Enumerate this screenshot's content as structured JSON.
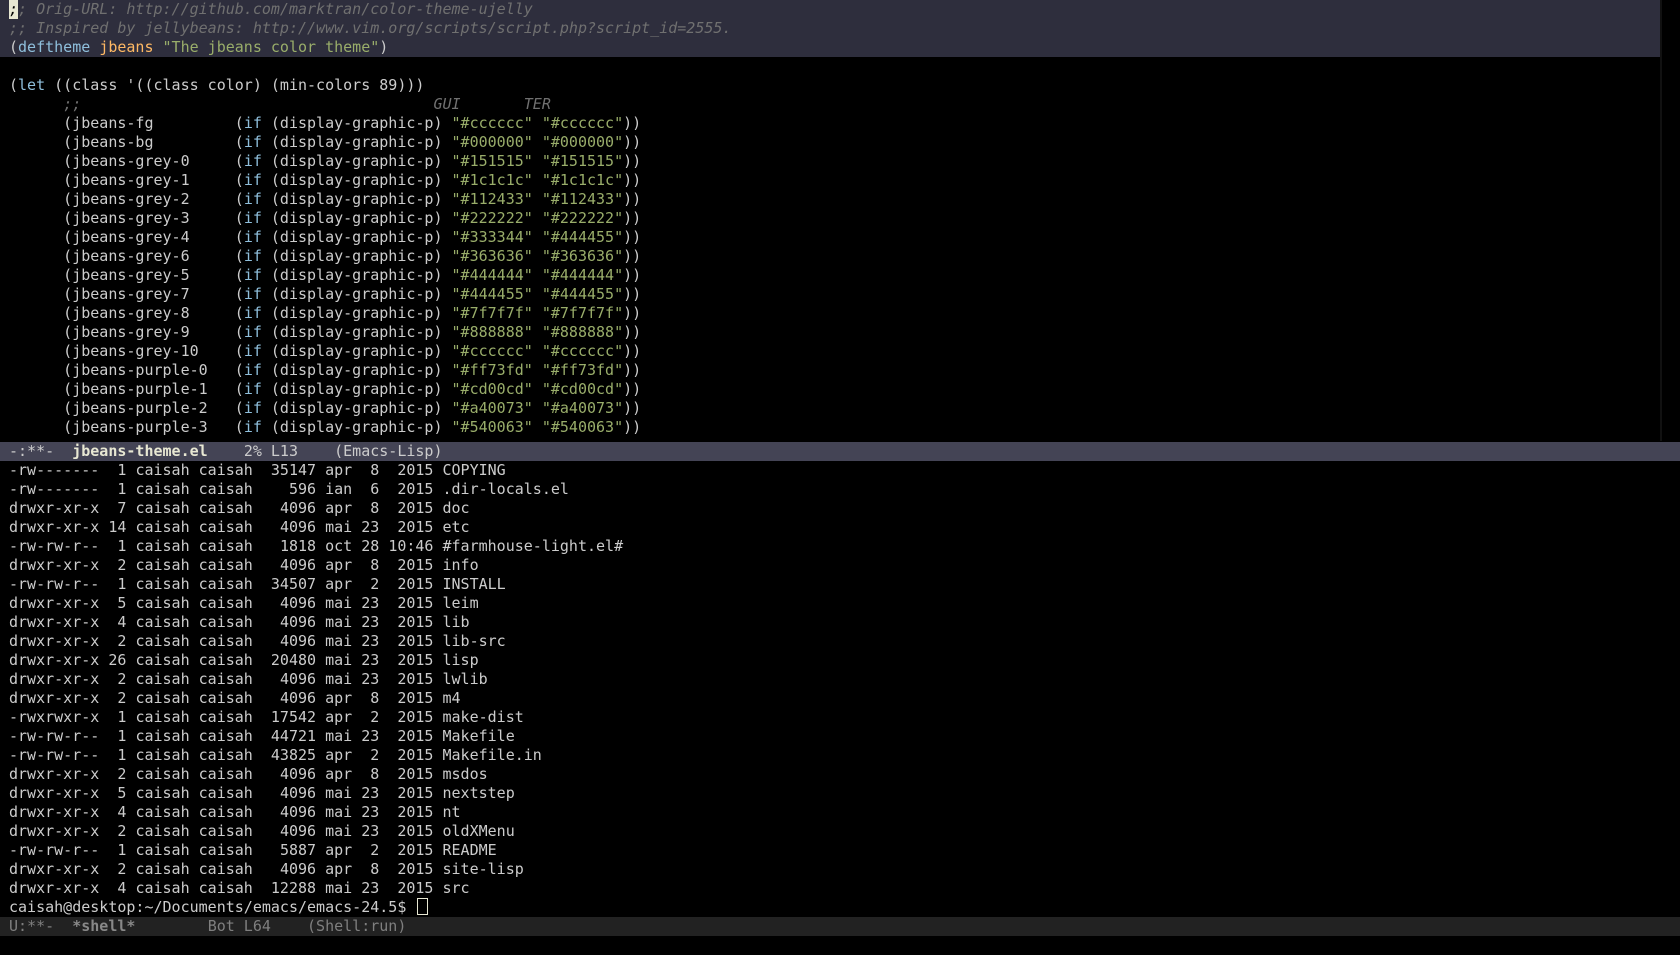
{
  "top_buffer": {
    "header_comments": [
      ";; Orig-URL: http://github.com/marktran/color-theme-ujelly",
      ";; Inspired by jellybeans: http://www.vim.org/scripts/script.php?script_id=2555."
    ],
    "deftheme": {
      "open": "(",
      "keyword": "deftheme",
      "name": "jbeans",
      "docstring": "\"The jbeans color theme\"",
      "close": ")"
    },
    "let_line": {
      "open": "(",
      "keyword": "let",
      "rest": " ((class '((class color) (min-colors 89)))"
    },
    "column_comment": ";;",
    "column_header_gui": "GUI",
    "column_header_ter": "TER",
    "color_rows": [
      {
        "name": "jbeans-fg",
        "gui": "\"#cccccc\"",
        "ter": "\"#cccccc\""
      },
      {
        "name": "jbeans-bg",
        "gui": "\"#000000\"",
        "ter": "\"#000000\""
      },
      {
        "name": "jbeans-grey-0",
        "gui": "\"#151515\"",
        "ter": "\"#151515\""
      },
      {
        "name": "jbeans-grey-1",
        "gui": "\"#1c1c1c\"",
        "ter": "\"#1c1c1c\""
      },
      {
        "name": "jbeans-grey-2",
        "gui": "\"#112433\"",
        "ter": "\"#112433\""
      },
      {
        "name": "jbeans-grey-3",
        "gui": "\"#222222\"",
        "ter": "\"#222222\""
      },
      {
        "name": "jbeans-grey-4",
        "gui": "\"#333344\"",
        "ter": "\"#444455\""
      },
      {
        "name": "jbeans-grey-6",
        "gui": "\"#363636\"",
        "ter": "\"#363636\""
      },
      {
        "name": "jbeans-grey-5",
        "gui": "\"#444444\"",
        "ter": "\"#444444\""
      },
      {
        "name": "jbeans-grey-7",
        "gui": "\"#444455\"",
        "ter": "\"#444455\""
      },
      {
        "name": "jbeans-grey-8",
        "gui": "\"#7f7f7f\"",
        "ter": "\"#7f7f7f\""
      },
      {
        "name": "jbeans-grey-9",
        "gui": "\"#888888\"",
        "ter": "\"#888888\""
      },
      {
        "name": "jbeans-grey-10",
        "gui": "\"#cccccc\"",
        "ter": "\"#cccccc\""
      },
      {
        "name": "jbeans-purple-0",
        "gui": "\"#ff73fd\"",
        "ter": "\"#ff73fd\""
      },
      {
        "name": "jbeans-purple-1",
        "gui": "\"#cd00cd\"",
        "ter": "\"#cd00cd\""
      },
      {
        "name": "jbeans-purple-2",
        "gui": "\"#a40073\"",
        "ter": "\"#a40073\""
      },
      {
        "name": "jbeans-purple-3",
        "gui": "\"#540063\"",
        "ter": "\"#540063\""
      }
    ],
    "if_keyword": "if",
    "predicate": "(display-graphic-p)"
  },
  "top_modeline": {
    "status": "-:**-",
    "buffer_name": "jbeans-theme.el",
    "position": "2% L13",
    "mode": "(Emacs-Lisp)"
  },
  "shell_buffer": {
    "listing": [
      {
        "perms": "-rw-------",
        "links": "1",
        "owner": "caisah",
        "group": "caisah",
        "size": "35147",
        "month": "apr",
        "day": "8",
        "time": "2015",
        "name": "COPYING"
      },
      {
        "perms": "-rw-------",
        "links": "1",
        "owner": "caisah",
        "group": "caisah",
        "size": "596",
        "month": "ian",
        "day": "6",
        "time": "2015",
        "name": ".dir-locals.el"
      },
      {
        "perms": "drwxr-xr-x",
        "links": "7",
        "owner": "caisah",
        "group": "caisah",
        "size": "4096",
        "month": "apr",
        "day": "8",
        "time": "2015",
        "name": "doc"
      },
      {
        "perms": "drwxr-xr-x",
        "links": "14",
        "owner": "caisah",
        "group": "caisah",
        "size": "4096",
        "month": "mai",
        "day": "23",
        "time": "2015",
        "name": "etc"
      },
      {
        "perms": "-rw-rw-r--",
        "links": "1",
        "owner": "caisah",
        "group": "caisah",
        "size": "1818",
        "month": "oct",
        "day": "28",
        "time": "10:46",
        "name": "#farmhouse-light.el#"
      },
      {
        "perms": "drwxr-xr-x",
        "links": "2",
        "owner": "caisah",
        "group": "caisah",
        "size": "4096",
        "month": "apr",
        "day": "8",
        "time": "2015",
        "name": "info"
      },
      {
        "perms": "-rw-rw-r--",
        "links": "1",
        "owner": "caisah",
        "group": "caisah",
        "size": "34507",
        "month": "apr",
        "day": "2",
        "time": "2015",
        "name": "INSTALL"
      },
      {
        "perms": "drwxr-xr-x",
        "links": "5",
        "owner": "caisah",
        "group": "caisah",
        "size": "4096",
        "month": "mai",
        "day": "23",
        "time": "2015",
        "name": "leim"
      },
      {
        "perms": "drwxr-xr-x",
        "links": "4",
        "owner": "caisah",
        "group": "caisah",
        "size": "4096",
        "month": "mai",
        "day": "23",
        "time": "2015",
        "name": "lib"
      },
      {
        "perms": "drwxr-xr-x",
        "links": "2",
        "owner": "caisah",
        "group": "caisah",
        "size": "4096",
        "month": "mai",
        "day": "23",
        "time": "2015",
        "name": "lib-src"
      },
      {
        "perms": "drwxr-xr-x",
        "links": "26",
        "owner": "caisah",
        "group": "caisah",
        "size": "20480",
        "month": "mai",
        "day": "23",
        "time": "2015",
        "name": "lisp"
      },
      {
        "perms": "drwxr-xr-x",
        "links": "2",
        "owner": "caisah",
        "group": "caisah",
        "size": "4096",
        "month": "mai",
        "day": "23",
        "time": "2015",
        "name": "lwlib"
      },
      {
        "perms": "drwxr-xr-x",
        "links": "2",
        "owner": "caisah",
        "group": "caisah",
        "size": "4096",
        "month": "apr",
        "day": "8",
        "time": "2015",
        "name": "m4"
      },
      {
        "perms": "-rwxrwxr-x",
        "links": "1",
        "owner": "caisah",
        "group": "caisah",
        "size": "17542",
        "month": "apr",
        "day": "2",
        "time": "2015",
        "name": "make-dist"
      },
      {
        "perms": "-rw-rw-r--",
        "links": "1",
        "owner": "caisah",
        "group": "caisah",
        "size": "44721",
        "month": "mai",
        "day": "23",
        "time": "2015",
        "name": "Makefile"
      },
      {
        "perms": "-rw-rw-r--",
        "links": "1",
        "owner": "caisah",
        "group": "caisah",
        "size": "43825",
        "month": "apr",
        "day": "2",
        "time": "2015",
        "name": "Makefile.in"
      },
      {
        "perms": "drwxr-xr-x",
        "links": "2",
        "owner": "caisah",
        "group": "caisah",
        "size": "4096",
        "month": "apr",
        "day": "8",
        "time": "2015",
        "name": "msdos"
      },
      {
        "perms": "drwxr-xr-x",
        "links": "5",
        "owner": "caisah",
        "group": "caisah",
        "size": "4096",
        "month": "mai",
        "day": "23",
        "time": "2015",
        "name": "nextstep"
      },
      {
        "perms": "drwxr-xr-x",
        "links": "4",
        "owner": "caisah",
        "group": "caisah",
        "size": "4096",
        "month": "mai",
        "day": "23",
        "time": "2015",
        "name": "nt"
      },
      {
        "perms": "drwxr-xr-x",
        "links": "2",
        "owner": "caisah",
        "group": "caisah",
        "size": "4096",
        "month": "mai",
        "day": "23",
        "time": "2015",
        "name": "oldXMenu"
      },
      {
        "perms": "-rw-rw-r--",
        "links": "1",
        "owner": "caisah",
        "group": "caisah",
        "size": "5887",
        "month": "apr",
        "day": "2",
        "time": "2015",
        "name": "README"
      },
      {
        "perms": "drwxr-xr-x",
        "links": "2",
        "owner": "caisah",
        "group": "caisah",
        "size": "4096",
        "month": "apr",
        "day": "8",
        "time": "2015",
        "name": "site-lisp"
      },
      {
        "perms": "drwxr-xr-x",
        "links": "4",
        "owner": "caisah",
        "group": "caisah",
        "size": "12288",
        "month": "mai",
        "day": "23",
        "time": "2015",
        "name": "src"
      }
    ],
    "prompt": "caisah@desktop:~/Documents/emacs/emacs-24.5$ "
  },
  "bottom_modeline": {
    "status": "U:**-",
    "buffer_name": "*shell*",
    "position": "Bot L64",
    "mode": "(Shell:run)"
  },
  "colors": {
    "background": "#000000",
    "foreground": "#cccccc",
    "comment": "#707070",
    "keyword": "#8fbfdc",
    "theme_name": "#ffb964",
    "string": "#99ad6a",
    "header_highlight": "#2e2e3d",
    "modeline_active": "#444455",
    "modeline_inactive": "#222222"
  }
}
